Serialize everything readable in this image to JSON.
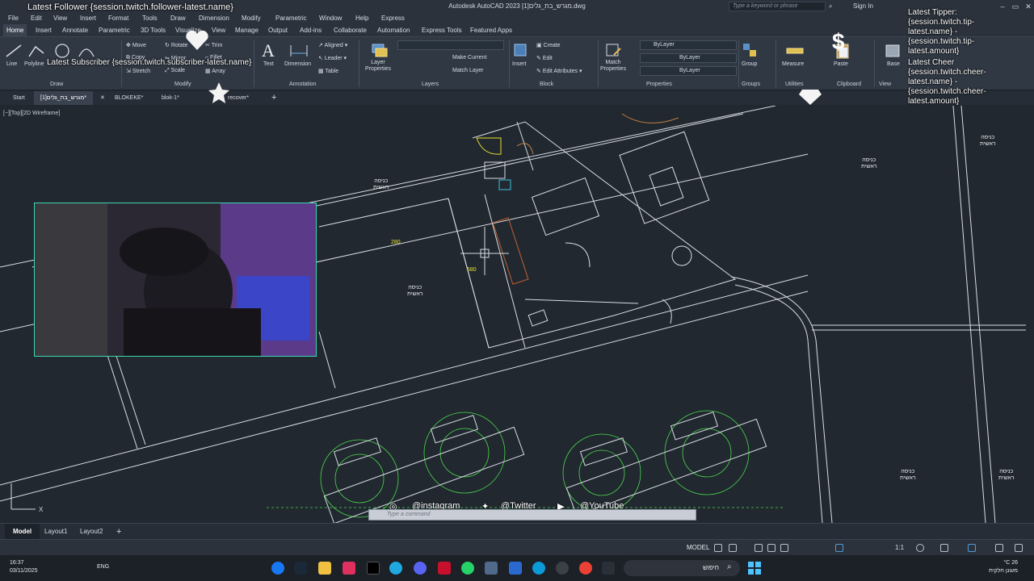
{
  "window": {
    "title": "Autodesk AutoCAD 2023  מגרש_בת_גלים[1].dwg",
    "search_placeholder": "Type a keyword or phrase",
    "signin": "Sign In"
  },
  "menubar": [
    "File",
    "Edit",
    "View",
    "Insert",
    "Format",
    "Tools",
    "Draw",
    "Dimension",
    "Modify",
    "Parametric",
    "Window",
    "Help",
    "Express"
  ],
  "ribbon_tabs": [
    "Home",
    "Insert",
    "Annotate",
    "Parametric",
    "3D Tools",
    "Visualize",
    "View",
    "Manage",
    "Output",
    "Add-ins",
    "Collaborate",
    "Automation",
    "Express Tools",
    "Featured Apps"
  ],
  "ribbon": {
    "draw": {
      "line": "Line",
      "polyline": "Polyline",
      "label": "Draw"
    },
    "modify": {
      "move": "Move",
      "rotate": "Rotate",
      "trim": "Trim",
      "copy": "Copy",
      "mirror": "Mirror",
      "fillet": "Fillet",
      "stretch": "Stretch",
      "scale": "Scale",
      "array": "Array",
      "label": "Modify"
    },
    "annotation": {
      "text": "Text",
      "dimension": "Dimension",
      "aligned": "Aligned",
      "leader": "Leader",
      "table": "Table",
      "label": "Annotation"
    },
    "layers": {
      "properties": "Layer Properties",
      "make_current": "Make Current",
      "match_layer": "Match Layer",
      "label": "Layers"
    },
    "block": {
      "insert": "Insert",
      "create": "Create",
      "edit": "Edit",
      "edit_attributes": "Edit Attributes",
      "label": "Block"
    },
    "properties": {
      "match": "Match Properties",
      "color": "ByLayer",
      "linetype": "ByLayer",
      "lineweight": "ByLayer",
      "label": "Properties"
    },
    "groups": {
      "group": "Group",
      "label": "Groups"
    },
    "utilities": {
      "measure": "Measure",
      "label": "Utilities"
    },
    "clipboard": {
      "paste": "Paste",
      "label": "Clipboard"
    },
    "view": {
      "base": "Base",
      "label": "View"
    }
  },
  "file_tabs": [
    "Start",
    "מגרש_בת_גלים[1]*",
    "BLOKEKE*",
    "blok-1*",
    "recover*"
  ],
  "view_label": "[−][Top][2D Wireframe]",
  "drawing": {
    "entrance_label": "כניסה\nראשית",
    "dim_280": "280",
    "dim_580": "580"
  },
  "overlays": {
    "latest_follower": "Latest Follower {session.twitch.follower-latest.name}",
    "latest_subscriber": "Latest Subscriber {session.twitch.subscriber-latest.name}",
    "latest_tipper": "Latest Tipper:\n{session.twitch.tip-\nlatest.name} -\n{session.twitch.tip-\nlatest.amount}",
    "latest_cheer": "Latest Cheer\n{session.twitch.cheer-\nlatest.name} -\n{session.twitch.cheer-\nlatest.amount}",
    "instagram": "@instagram",
    "twitter": "@Twitter",
    "youtube": "@YouTube"
  },
  "command_placeholder": "Type a command",
  "layout_tabs": [
    "Model",
    "Layout1",
    "Layout2"
  ],
  "status": {
    "model": "MODEL",
    "scale": "1:1"
  },
  "taskbar": {
    "time": "16:37",
    "date": "03/11/2025",
    "lang": "ENG",
    "search": "חיפוש",
    "weather": "°C 26",
    "weather_desc": "מעונן חלקית"
  },
  "colors": {
    "canvas": "#212830",
    "cad_line": "#d8dde3",
    "yellow": "#e8e030",
    "green": "#4cd94c",
    "cyan": "#40c0e0",
    "accent": "#3cd6b0"
  }
}
